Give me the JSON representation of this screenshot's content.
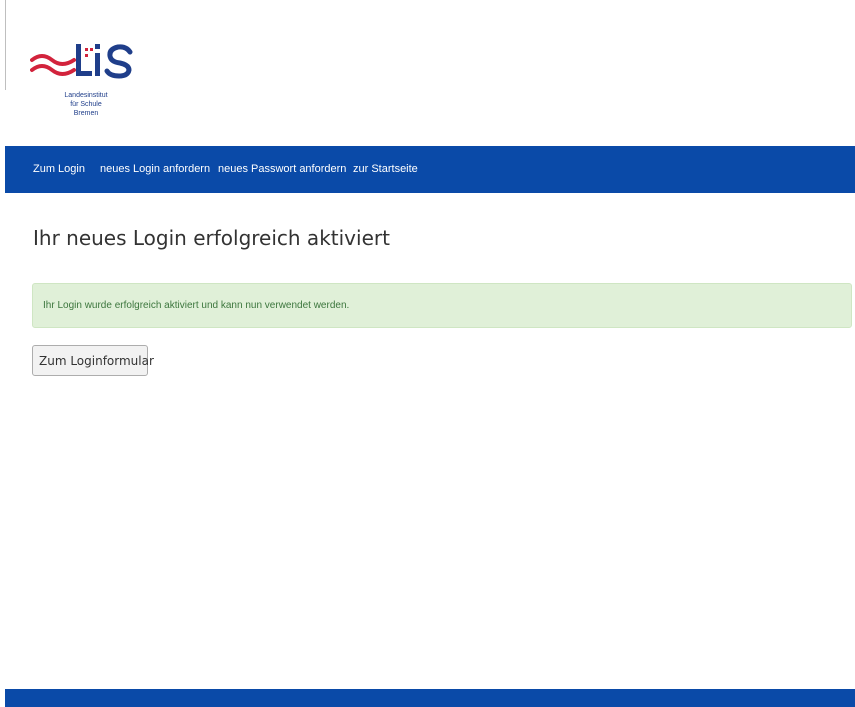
{
  "logo": {
    "mark_text": "LIS",
    "caption_lines": [
      "Landesinstitut",
      "für Schule",
      "Bremen"
    ]
  },
  "nav": {
    "items": [
      {
        "label": "Zum Login"
      },
      {
        "label": "neues Login anfordern"
      },
      {
        "label": "neues Passwort anfordern"
      },
      {
        "label": "zur Startseite"
      }
    ]
  },
  "page": {
    "title": "Ihr neues Login erfolgreich aktiviert",
    "alert_text": "Ihr Login wurde erfolgreich aktiviert und kann nun verwendet werden.",
    "button_label": "Zum Loginformular"
  },
  "colors": {
    "nav_background": "#0a4aa8",
    "alert_background": "#e0f0d8",
    "alert_text": "#3c763d",
    "logo_red": "#d2233c",
    "logo_blue": "#1f3e8a"
  }
}
